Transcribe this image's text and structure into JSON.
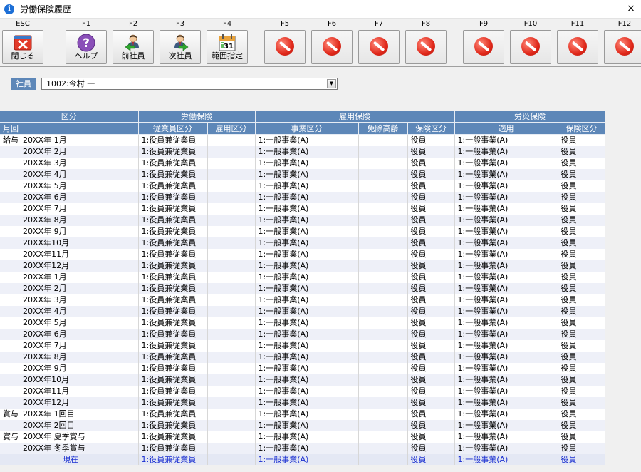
{
  "window": {
    "title": "労働保険履歴",
    "close_glyph": "×"
  },
  "toolbar": {
    "keys": [
      {
        "key": "ESC",
        "label": "閉じる",
        "icon": "close-icon",
        "enabled": true
      },
      {
        "key": "F1",
        "label": "ヘルプ",
        "icon": "help-icon",
        "enabled": true
      },
      {
        "key": "F2",
        "label": "前社員",
        "icon": "prev-employee-icon",
        "enabled": true
      },
      {
        "key": "F3",
        "label": "次社員",
        "icon": "next-employee-icon",
        "enabled": true
      },
      {
        "key": "F4",
        "label": "範囲指定",
        "icon": "calendar-icon",
        "enabled": true,
        "calendar_day": "31"
      },
      {
        "key": "F5",
        "label": "",
        "icon": "disabled-icon",
        "enabled": false
      },
      {
        "key": "F6",
        "label": "",
        "icon": "disabled-icon",
        "enabled": false
      },
      {
        "key": "F7",
        "label": "",
        "icon": "disabled-icon",
        "enabled": false
      },
      {
        "key": "F8",
        "label": "",
        "icon": "disabled-icon",
        "enabled": false
      },
      {
        "key": "F9",
        "label": "",
        "icon": "disabled-icon",
        "enabled": false
      },
      {
        "key": "F10",
        "label": "",
        "icon": "disabled-icon",
        "enabled": false
      },
      {
        "key": "F11",
        "label": "",
        "icon": "disabled-icon",
        "enabled": false
      },
      {
        "key": "F12",
        "label": "",
        "icon": "disabled-icon",
        "enabled": false
      }
    ]
  },
  "employee": {
    "label": "社員",
    "value": "1002:今村 一",
    "dropdown_glyph": "▼"
  },
  "grid": {
    "group_headers": {
      "kubun": "区分",
      "rodo": "労働保険",
      "koyo": "雇用保険",
      "rosai": "労災保険"
    },
    "sub_headers": {
      "tsukikai": "月回",
      "jugyoin": "従業員区分",
      "koyo_kubun": "雇用区分",
      "jigyo": "事業区分",
      "menjo": "免除高齢",
      "hoken_kubun": "保険区分",
      "tekiyo": "適用",
      "hoken_kubun2": "保険区分"
    },
    "rows": [
      {
        "group": "給与",
        "period": "20XX年 1月",
        "jugyoin": "1:役員兼従業員",
        "koyo_kubun": "",
        "jigyo": "1:一般事業(A)",
        "menjo": "",
        "hoken": "役員",
        "tekiyo": "1:一般事業(A)",
        "hoken2": "役員"
      },
      {
        "group": "",
        "period": "20XX年 2月",
        "jugyoin": "1:役員兼従業員",
        "koyo_kubun": "",
        "jigyo": "1:一般事業(A)",
        "menjo": "",
        "hoken": "役員",
        "tekiyo": "1:一般事業(A)",
        "hoken2": "役員"
      },
      {
        "group": "",
        "period": "20XX年 3月",
        "jugyoin": "1:役員兼従業員",
        "koyo_kubun": "",
        "jigyo": "1:一般事業(A)",
        "menjo": "",
        "hoken": "役員",
        "tekiyo": "1:一般事業(A)",
        "hoken2": "役員"
      },
      {
        "group": "",
        "period": "20XX年 4月",
        "jugyoin": "1:役員兼従業員",
        "koyo_kubun": "",
        "jigyo": "1:一般事業(A)",
        "menjo": "",
        "hoken": "役員",
        "tekiyo": "1:一般事業(A)",
        "hoken2": "役員"
      },
      {
        "group": "",
        "period": "20XX年 5月",
        "jugyoin": "1:役員兼従業員",
        "koyo_kubun": "",
        "jigyo": "1:一般事業(A)",
        "menjo": "",
        "hoken": "役員",
        "tekiyo": "1:一般事業(A)",
        "hoken2": "役員"
      },
      {
        "group": "",
        "period": "20XX年 6月",
        "jugyoin": "1:役員兼従業員",
        "koyo_kubun": "",
        "jigyo": "1:一般事業(A)",
        "menjo": "",
        "hoken": "役員",
        "tekiyo": "1:一般事業(A)",
        "hoken2": "役員"
      },
      {
        "group": "",
        "period": "20XX年 7月",
        "jugyoin": "1:役員兼従業員",
        "koyo_kubun": "",
        "jigyo": "1:一般事業(A)",
        "menjo": "",
        "hoken": "役員",
        "tekiyo": "1:一般事業(A)",
        "hoken2": "役員"
      },
      {
        "group": "",
        "period": "20XX年 8月",
        "jugyoin": "1:役員兼従業員",
        "koyo_kubun": "",
        "jigyo": "1:一般事業(A)",
        "menjo": "",
        "hoken": "役員",
        "tekiyo": "1:一般事業(A)",
        "hoken2": "役員"
      },
      {
        "group": "",
        "period": "20XX年 9月",
        "jugyoin": "1:役員兼従業員",
        "koyo_kubun": "",
        "jigyo": "1:一般事業(A)",
        "menjo": "",
        "hoken": "役員",
        "tekiyo": "1:一般事業(A)",
        "hoken2": "役員"
      },
      {
        "group": "",
        "period": "20XX年10月",
        "jugyoin": "1:役員兼従業員",
        "koyo_kubun": "",
        "jigyo": "1:一般事業(A)",
        "menjo": "",
        "hoken": "役員",
        "tekiyo": "1:一般事業(A)",
        "hoken2": "役員"
      },
      {
        "group": "",
        "period": "20XX年11月",
        "jugyoin": "1:役員兼従業員",
        "koyo_kubun": "",
        "jigyo": "1:一般事業(A)",
        "menjo": "",
        "hoken": "役員",
        "tekiyo": "1:一般事業(A)",
        "hoken2": "役員"
      },
      {
        "group": "",
        "period": "20XX年12月",
        "jugyoin": "1:役員兼従業員",
        "koyo_kubun": "",
        "jigyo": "1:一般事業(A)",
        "menjo": "",
        "hoken": "役員",
        "tekiyo": "1:一般事業(A)",
        "hoken2": "役員"
      },
      {
        "group": "",
        "period": "20XX年 1月",
        "jugyoin": "1:役員兼従業員",
        "koyo_kubun": "",
        "jigyo": "1:一般事業(A)",
        "menjo": "",
        "hoken": "役員",
        "tekiyo": "1:一般事業(A)",
        "hoken2": "役員"
      },
      {
        "group": "",
        "period": "20XX年 2月",
        "jugyoin": "1:役員兼従業員",
        "koyo_kubun": "",
        "jigyo": "1:一般事業(A)",
        "menjo": "",
        "hoken": "役員",
        "tekiyo": "1:一般事業(A)",
        "hoken2": "役員"
      },
      {
        "group": "",
        "period": "20XX年 3月",
        "jugyoin": "1:役員兼従業員",
        "koyo_kubun": "",
        "jigyo": "1:一般事業(A)",
        "menjo": "",
        "hoken": "役員",
        "tekiyo": "1:一般事業(A)",
        "hoken2": "役員"
      },
      {
        "group": "",
        "period": "20XX年 4月",
        "jugyoin": "1:役員兼従業員",
        "koyo_kubun": "",
        "jigyo": "1:一般事業(A)",
        "menjo": "",
        "hoken": "役員",
        "tekiyo": "1:一般事業(A)",
        "hoken2": "役員"
      },
      {
        "group": "",
        "period": "20XX年 5月",
        "jugyoin": "1:役員兼従業員",
        "koyo_kubun": "",
        "jigyo": "1:一般事業(A)",
        "menjo": "",
        "hoken": "役員",
        "tekiyo": "1:一般事業(A)",
        "hoken2": "役員"
      },
      {
        "group": "",
        "period": "20XX年 6月",
        "jugyoin": "1:役員兼従業員",
        "koyo_kubun": "",
        "jigyo": "1:一般事業(A)",
        "menjo": "",
        "hoken": "役員",
        "tekiyo": "1:一般事業(A)",
        "hoken2": "役員"
      },
      {
        "group": "",
        "period": "20XX年 7月",
        "jugyoin": "1:役員兼従業員",
        "koyo_kubun": "",
        "jigyo": "1:一般事業(A)",
        "menjo": "",
        "hoken": "役員",
        "tekiyo": "1:一般事業(A)",
        "hoken2": "役員"
      },
      {
        "group": "",
        "period": "20XX年 8月",
        "jugyoin": "1:役員兼従業員",
        "koyo_kubun": "",
        "jigyo": "1:一般事業(A)",
        "menjo": "",
        "hoken": "役員",
        "tekiyo": "1:一般事業(A)",
        "hoken2": "役員"
      },
      {
        "group": "",
        "period": "20XX年 9月",
        "jugyoin": "1:役員兼従業員",
        "koyo_kubun": "",
        "jigyo": "1:一般事業(A)",
        "menjo": "",
        "hoken": "役員",
        "tekiyo": "1:一般事業(A)",
        "hoken2": "役員"
      },
      {
        "group": "",
        "period": "20XX年10月",
        "jugyoin": "1:役員兼従業員",
        "koyo_kubun": "",
        "jigyo": "1:一般事業(A)",
        "menjo": "",
        "hoken": "役員",
        "tekiyo": "1:一般事業(A)",
        "hoken2": "役員"
      },
      {
        "group": "",
        "period": "20XX年11月",
        "jugyoin": "1:役員兼従業員",
        "koyo_kubun": "",
        "jigyo": "1:一般事業(A)",
        "menjo": "",
        "hoken": "役員",
        "tekiyo": "1:一般事業(A)",
        "hoken2": "役員"
      },
      {
        "group": "",
        "period": "20XX年12月",
        "jugyoin": "1:役員兼従業員",
        "koyo_kubun": "",
        "jigyo": "1:一般事業(A)",
        "menjo": "",
        "hoken": "役員",
        "tekiyo": "1:一般事業(A)",
        "hoken2": "役員"
      },
      {
        "group": "賞与",
        "period": "20XX年 1回目",
        "jugyoin": "1:役員兼従業員",
        "koyo_kubun": "",
        "jigyo": "1:一般事業(A)",
        "menjo": "",
        "hoken": "役員",
        "tekiyo": "1:一般事業(A)",
        "hoken2": "役員"
      },
      {
        "group": "",
        "period": "20XX年 2回目",
        "jugyoin": "1:役員兼従業員",
        "koyo_kubun": "",
        "jigyo": "1:一般事業(A)",
        "menjo": "",
        "hoken": "役員",
        "tekiyo": "1:一般事業(A)",
        "hoken2": "役員"
      },
      {
        "group": "賞与",
        "period": "20XX年 夏季賞与",
        "jugyoin": "1:役員兼従業員",
        "koyo_kubun": "",
        "jigyo": "1:一般事業(A)",
        "menjo": "",
        "hoken": "役員",
        "tekiyo": "1:一般事業(A)",
        "hoken2": "役員"
      },
      {
        "group": "",
        "period": "20XX年 冬季賞与",
        "jugyoin": "1:役員兼従業員",
        "koyo_kubun": "",
        "jigyo": "1:一般事業(A)",
        "menjo": "",
        "hoken": "役員",
        "tekiyo": "1:一般事業(A)",
        "hoken2": "役員"
      }
    ],
    "current_row": {
      "period": "現在",
      "jugyoin": "1:役員兼従業員",
      "koyo_kubun": "",
      "jigyo": "1:一般事業(A)",
      "menjo": "",
      "hoken": "役員",
      "tekiyo": "1:一般事業(A)",
      "hoken2": "役員"
    }
  },
  "colors": {
    "header_bg": "#5d87b8",
    "row_alt": "#eef0f8",
    "current_text": "#1a2fd0",
    "disabled_red": "#e0281a"
  }
}
